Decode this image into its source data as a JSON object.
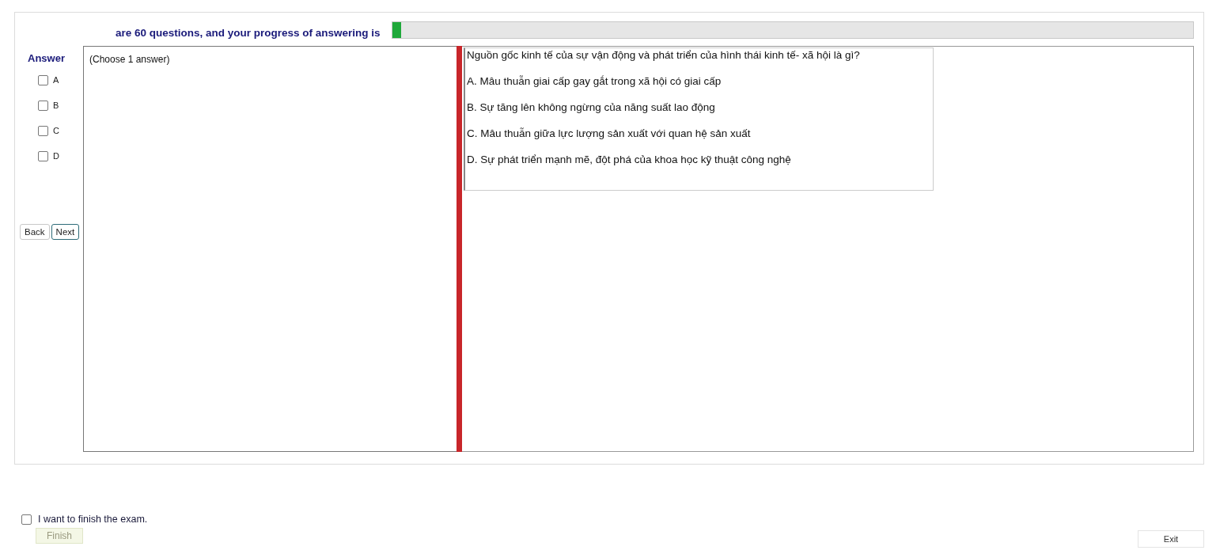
{
  "header": {
    "text": "are 60 questions, and your progress of answering is",
    "progress": {
      "level": 0.011
    }
  },
  "answer_panel": {
    "title": "Answer",
    "options": [
      {
        "label": "A",
        "checked": false
      },
      {
        "label": "B",
        "checked": false
      },
      {
        "label": "C",
        "checked": false
      },
      {
        "label": "D",
        "checked": false
      }
    ]
  },
  "navigation": [
    {
      "label": "Back",
      "selected": false
    },
    {
      "label": "Next",
      "selected": true
    }
  ],
  "instruction": "(Choose 1 answer)",
  "question": {
    "text": "Nguồn gốc kinh tế của sự vận động và phát triển của hình thái kinh tế- xã hội là gì?",
    "choices": [
      "A.  Mâu thuẫn giai cấp gay gắt trong xã hội có giai cấp",
      "B.  Sự tăng lên không ngừng của năng suất lao động",
      "C.  Mâu thuẫn giữa lực lượng sản xuất với quan hệ sản xuất",
      "D.  Sự phát triển mạnh mẽ, đột phá của khoa học kỹ thuật công nghệ"
    ]
  },
  "finish": {
    "label": "I want to finish the exam.",
    "checked": false,
    "button": "Finish",
    "button_disabled": true
  },
  "exit_button": "Exit"
}
